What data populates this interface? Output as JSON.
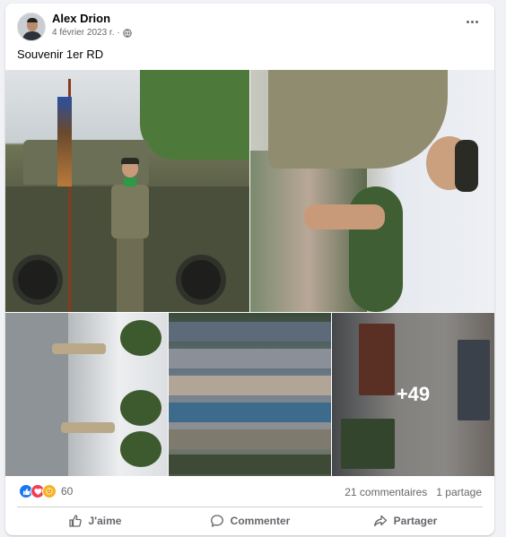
{
  "post": {
    "author": "Alex Drion",
    "date": "4 février 2023 r. ·",
    "caption": "Souvenir 1er RD"
  },
  "photos": {
    "more_count": "+49"
  },
  "stats": {
    "reaction_count": "60",
    "comments": "21 commentaires",
    "shares": "1 partage"
  },
  "actions": {
    "like": "J'aime",
    "comment": "Commenter",
    "share": "Partager"
  },
  "colors": {
    "like_blue": "#1877f2",
    "love_red": "#f33e58",
    "care_yellow": "#f7b125",
    "secondary_text": "#65676b"
  }
}
